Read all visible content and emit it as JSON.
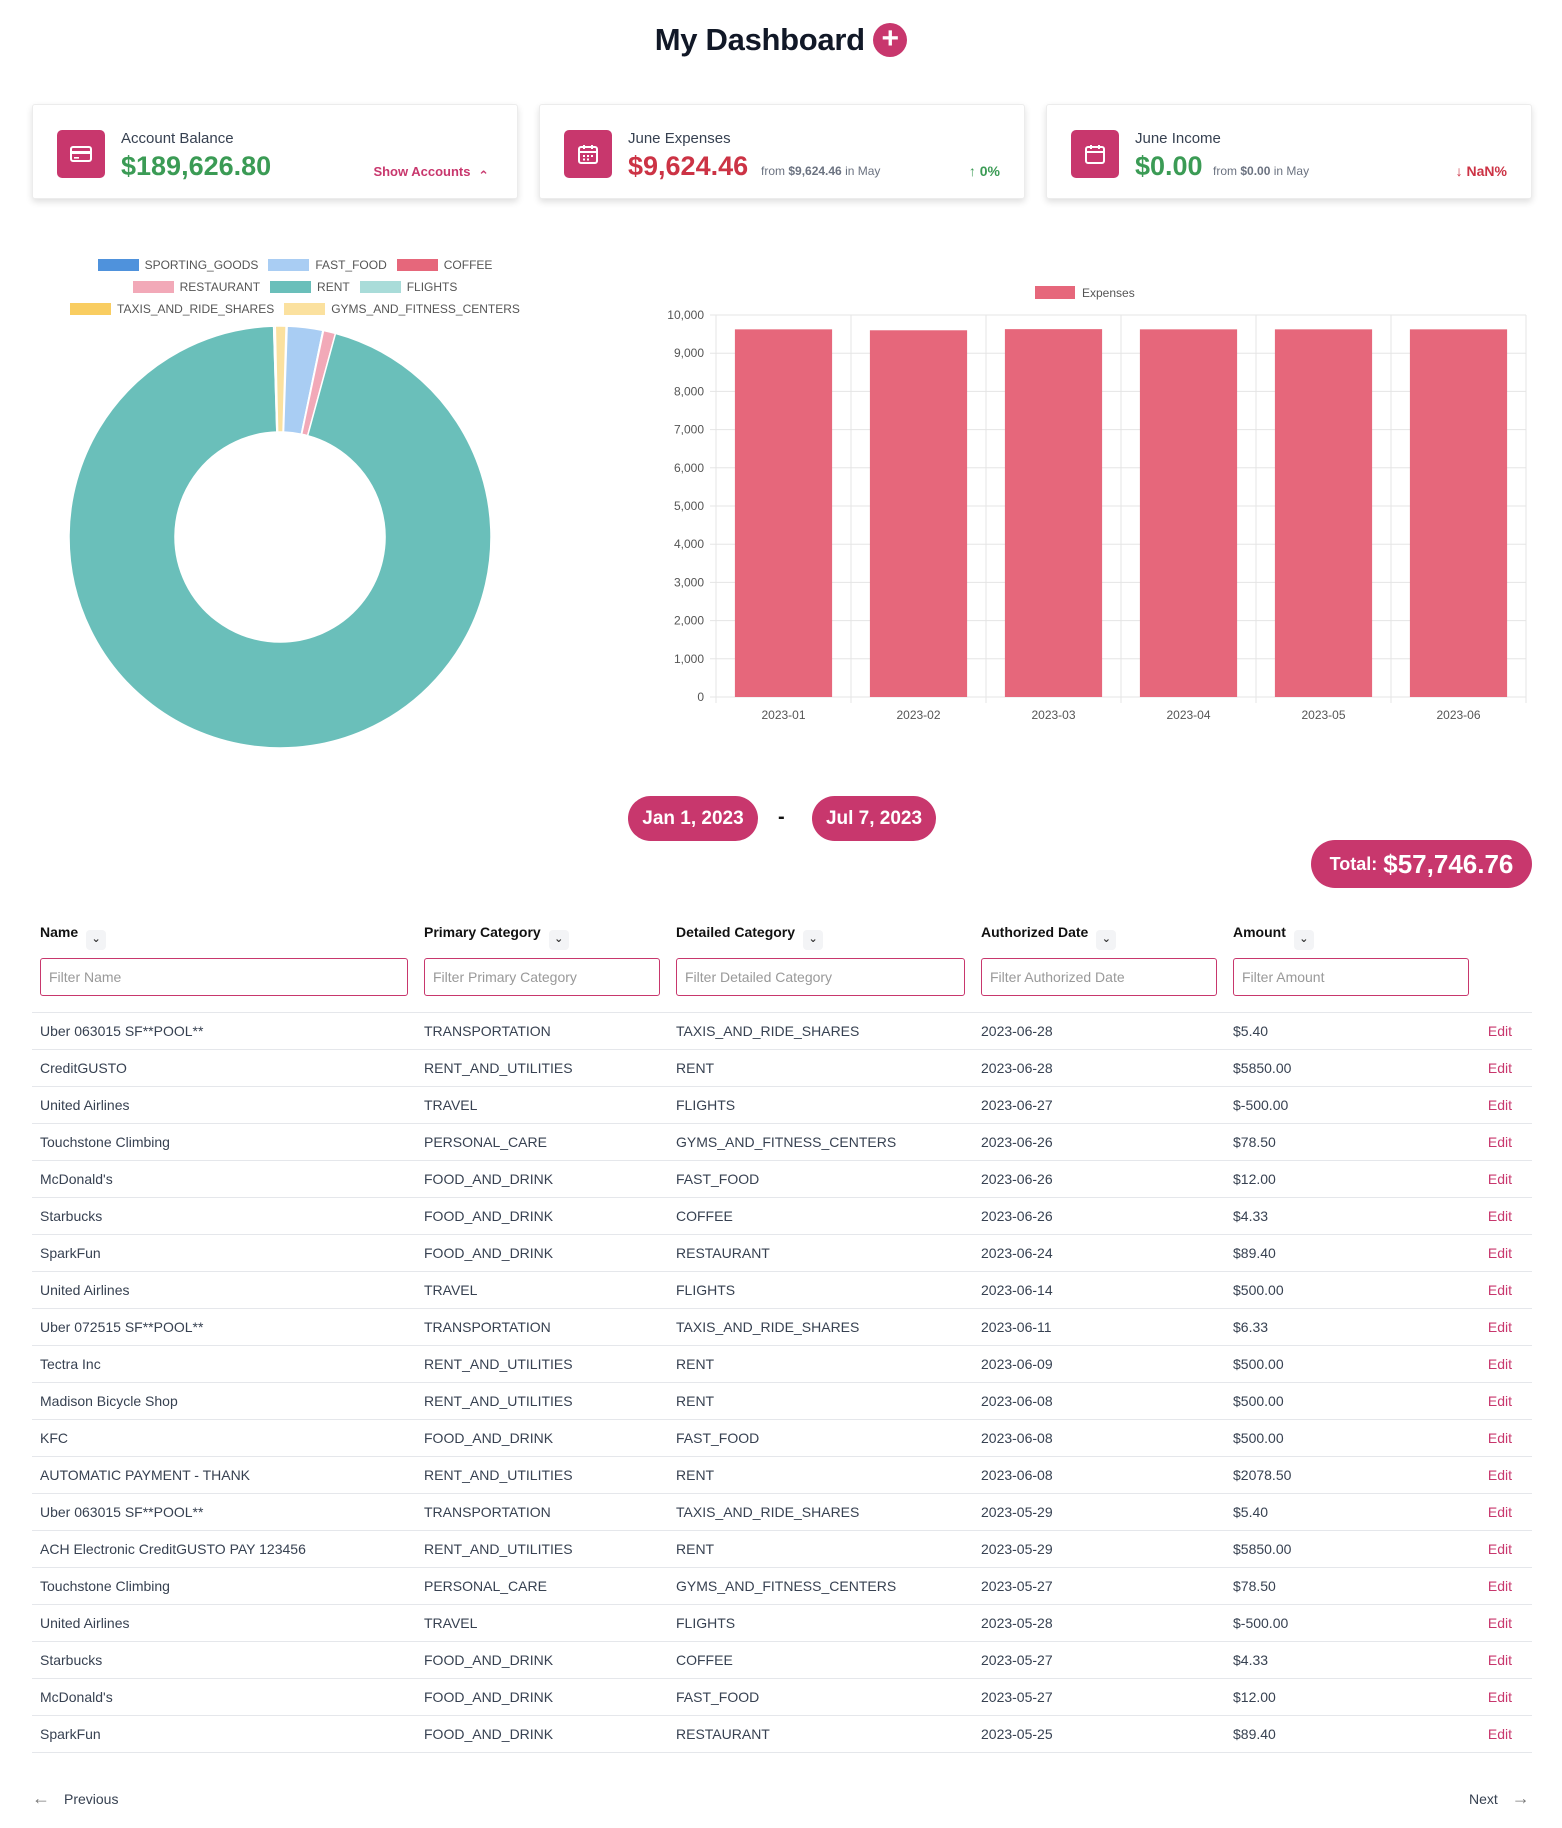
{
  "header": {
    "title": "My Dashboard",
    "add_symbol": "+"
  },
  "cards": {
    "balance": {
      "label": "Account Balance",
      "value": "$189,626.80",
      "toggle_label": "Show Accounts",
      "toggle_arrow": "⌃"
    },
    "expenses": {
      "label": "June Expenses",
      "value": "$9,624.46",
      "from_prefix": "from",
      "from_value": "$9,624.46",
      "from_suffix": "in May",
      "delta": "0%",
      "delta_arrow": "↑"
    },
    "income": {
      "label": "June Income",
      "value": "$0.00",
      "from_prefix": "from",
      "from_value": "$0.00",
      "from_suffix": "in May",
      "delta": "NaN%",
      "delta_arrow": "↓"
    }
  },
  "colors": {
    "accent": "#c8376d",
    "positive": "#3b9b55",
    "negative": "#cc3345"
  },
  "chart_data": [
    {
      "type": "pie",
      "donut": true,
      "legend_position": "top",
      "categories": [
        "SPORTING_GOODS",
        "FAST_FOOD",
        "COFFEE",
        "RESTAURANT",
        "RENT",
        "FLIGHTS",
        "TAXIS_AND_RIDE_SHARES",
        "GYMS_AND_FITNESS_CENTERS"
      ],
      "values": [
        15,
        524,
        8.66,
        178.8,
        18328,
        0,
        23.86,
        157
      ],
      "colors": [
        "#4f92dc",
        "#a9cdf3",
        "#e6677b",
        "#f2a9b8",
        "#6abfba",
        "#a9dcd9",
        "#f9cd61",
        "#fbe19f"
      ]
    },
    {
      "type": "bar",
      "categories": [
        "2023-01",
        "2023-02",
        "2023-03",
        "2023-04",
        "2023-05",
        "2023-06"
      ],
      "series": [
        {
          "name": "Expenses",
          "values": [
            9624.46,
            9600,
            9630,
            9624.46,
            9624.46,
            9624.46
          ],
          "color": "#e6677b"
        }
      ],
      "ylim": [
        0,
        10000
      ],
      "yticks": [
        "0",
        "1,000",
        "2,000",
        "3,000",
        "4,000",
        "5,000",
        "6,000",
        "7,000",
        "8,000",
        "9,000",
        "10,000"
      ],
      "legend_position": "top",
      "grid": true
    }
  ],
  "dates": {
    "start": "Jan 1, 2023",
    "sep": "-",
    "end": "Jul 7, 2023"
  },
  "total": {
    "label": "Total:",
    "value": "$57,746.76"
  },
  "table": {
    "columns": [
      "Name",
      "Primary Category",
      "Detailed Category",
      "Authorized Date",
      "Amount"
    ],
    "filters": [
      "Filter Name",
      "Filter Primary Category",
      "Filter Detailed Category",
      "Filter Authorized Date",
      "Filter Amount"
    ],
    "edit_label": "Edit",
    "chevron": "⌄",
    "rows": [
      [
        "Uber 063015 SF**POOL**",
        "TRANSPORTATION",
        "TAXIS_AND_RIDE_SHARES",
        "2023-06-28",
        "$5.40"
      ],
      [
        "CreditGUSTO",
        "RENT_AND_UTILITIES",
        "RENT",
        "2023-06-28",
        "$5850.00"
      ],
      [
        "United Airlines",
        "TRAVEL",
        "FLIGHTS",
        "2023-06-27",
        "$-500.00"
      ],
      [
        "Touchstone Climbing",
        "PERSONAL_CARE",
        "GYMS_AND_FITNESS_CENTERS",
        "2023-06-26",
        "$78.50"
      ],
      [
        "McDonald's",
        "FOOD_AND_DRINK",
        "FAST_FOOD",
        "2023-06-26",
        "$12.00"
      ],
      [
        "Starbucks",
        "FOOD_AND_DRINK",
        "COFFEE",
        "2023-06-26",
        "$4.33"
      ],
      [
        "SparkFun",
        "FOOD_AND_DRINK",
        "RESTAURANT",
        "2023-06-24",
        "$89.40"
      ],
      [
        "United Airlines",
        "TRAVEL",
        "FLIGHTS",
        "2023-06-14",
        "$500.00"
      ],
      [
        "Uber 072515 SF**POOL**",
        "TRANSPORTATION",
        "TAXIS_AND_RIDE_SHARES",
        "2023-06-11",
        "$6.33"
      ],
      [
        "Tectra Inc",
        "RENT_AND_UTILITIES",
        "RENT",
        "2023-06-09",
        "$500.00"
      ],
      [
        "Madison Bicycle Shop",
        "RENT_AND_UTILITIES",
        "RENT",
        "2023-06-08",
        "$500.00"
      ],
      [
        "KFC",
        "FOOD_AND_DRINK",
        "FAST_FOOD",
        "2023-06-08",
        "$500.00"
      ],
      [
        "AUTOMATIC PAYMENT - THANK",
        "RENT_AND_UTILITIES",
        "RENT",
        "2023-06-08",
        "$2078.50"
      ],
      [
        "Uber 063015 SF**POOL**",
        "TRANSPORTATION",
        "TAXIS_AND_RIDE_SHARES",
        "2023-05-29",
        "$5.40"
      ],
      [
        "ACH Electronic CreditGUSTO PAY 123456",
        "RENT_AND_UTILITIES",
        "RENT",
        "2023-05-29",
        "$5850.00"
      ],
      [
        "Touchstone Climbing",
        "PERSONAL_CARE",
        "GYMS_AND_FITNESS_CENTERS",
        "2023-05-27",
        "$78.50"
      ],
      [
        "United Airlines",
        "TRAVEL",
        "FLIGHTS",
        "2023-05-28",
        "$-500.00"
      ],
      [
        "Starbucks",
        "FOOD_AND_DRINK",
        "COFFEE",
        "2023-05-27",
        "$4.33"
      ],
      [
        "McDonald's",
        "FOOD_AND_DRINK",
        "FAST_FOOD",
        "2023-05-27",
        "$12.00"
      ],
      [
        "SparkFun",
        "FOOD_AND_DRINK",
        "RESTAURANT",
        "2023-05-25",
        "$89.40"
      ]
    ]
  },
  "pagination": {
    "previous": "Previous",
    "next": "Next",
    "prev_arrow": "←",
    "next_arrow": "→"
  }
}
